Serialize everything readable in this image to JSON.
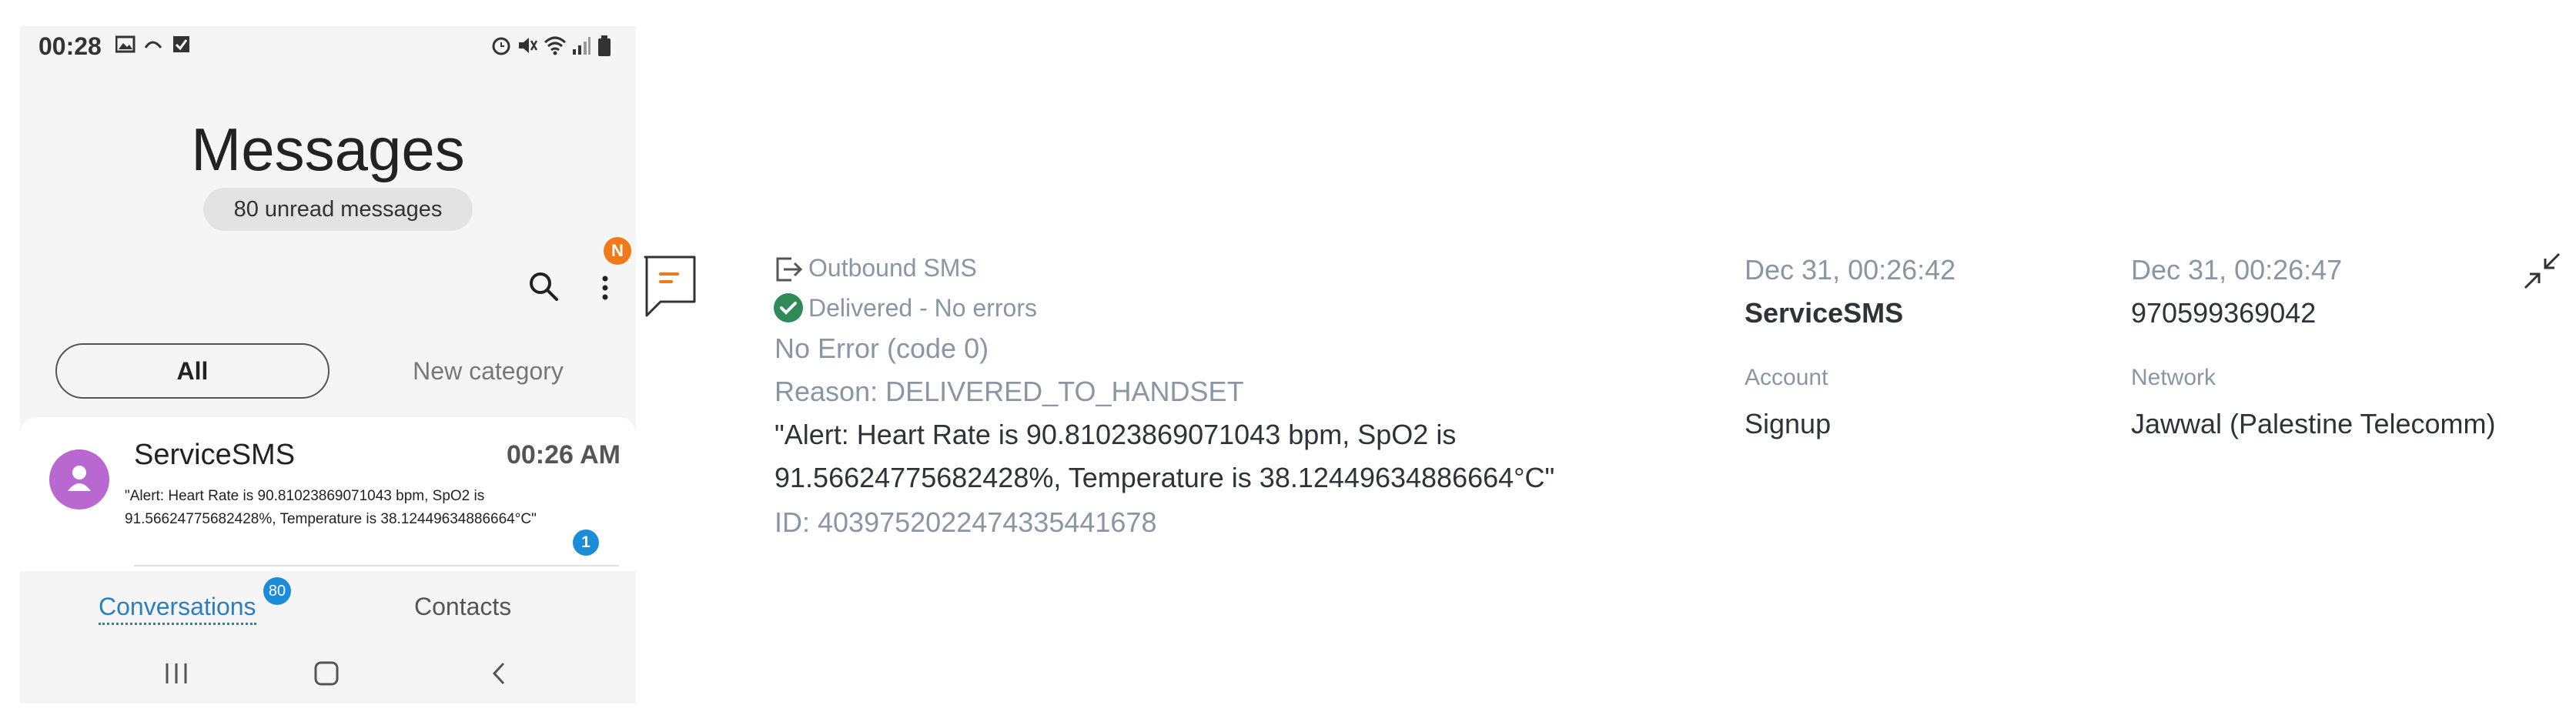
{
  "phone": {
    "status_time": "00:28",
    "title": "Messages",
    "unread": "80 unread messages",
    "notification_badge": "N",
    "tabs": [
      "All",
      "New category"
    ],
    "conversation": {
      "sender": "ServiceSMS",
      "time": "00:26 AM",
      "snippet_line1": "\"Alert: Heart Rate is 90.81023869071043 bpm, SpO2 is",
      "snippet_line2": "91.56624775682428%, Temperature is 38.12449634886664°C\"",
      "unread_count": "1"
    },
    "bottom_nav": {
      "conversations": "Conversations",
      "conversations_badge": "80",
      "contacts": "Contacts"
    }
  },
  "detail": {
    "direction": "Outbound SMS",
    "status": "Delivered - No errors",
    "error": "No Error (code 0)",
    "reason": "Reason: DELIVERED_TO_HANDSET",
    "body_line1": "\"Alert: Heart Rate is 90.81023869071043 bpm, SpO2 is",
    "body_line2": "91.56624775682428%, Temperature is 38.12449634886664°C\"",
    "id": "ID: 4039752022474335441678",
    "sent_time": "Dec 31, 00:26:42",
    "from": "ServiceSMS",
    "account_label": "Account",
    "account": "Signup",
    "received_time": "Dec 31, 00:26:47",
    "to": "970599369042",
    "network_label": "Network",
    "network": "Jawwal (Palestine Telecomm)"
  },
  "colors": {
    "accent_orange": "#f07a1a",
    "badge_blue": "#1b8dd6",
    "delivered_green": "#2e8b57",
    "muted_text": "#8a96a3"
  },
  "icons": [
    "image-icon",
    "call-icon",
    "check-box-icon",
    "alarm-icon",
    "mute-icon",
    "wifi-icon",
    "signal-icon",
    "battery-icon",
    "search-icon",
    "more-icon",
    "avatar-person-icon",
    "recent-apps-icon",
    "home-icon",
    "back-icon",
    "message-icon",
    "outbound-icon",
    "check-circle-icon",
    "collapse-icon"
  ]
}
